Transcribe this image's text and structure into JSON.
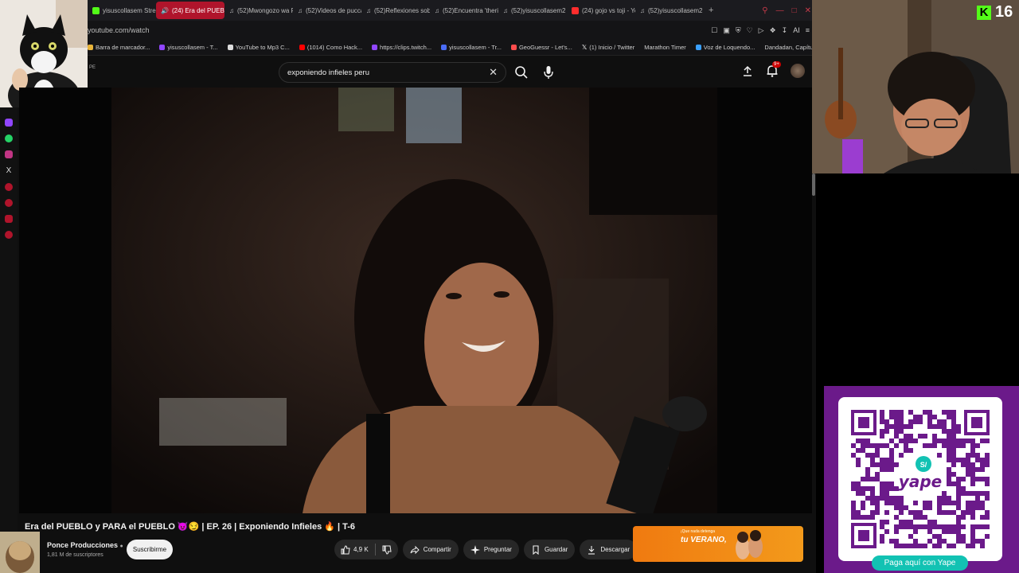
{
  "browser": {
    "tabs": [
      {
        "label": "yisuscollasem Stream",
        "color": "#53fc18"
      },
      {
        "label": "(24) Era del PUEBLO y",
        "color": "#ffffff",
        "active": true
      },
      {
        "label": "(52)Mwongozo wa P",
        "color": "#ffffff"
      },
      {
        "label": "(52)Videos de pucca",
        "color": "#ffffff"
      },
      {
        "label": "(52)Reflexiones sob",
        "color": "#ffffff"
      },
      {
        "label": "(52)Encuentra 'theric",
        "color": "#ffffff"
      },
      {
        "label": "(52)yisuscollasem2",
        "color": "#ffffff"
      },
      {
        "label": "(24) gojo vs toji - Yo",
        "color": "#ff2d2d"
      },
      {
        "label": "(52)yisuscollasem2",
        "color": "#ffffff"
      }
    ],
    "url": "youtube.com/watch",
    "addr_icons_label": "AI",
    "bookmarks": [
      {
        "label": "Barra de marcador...",
        "color": "#e8b43a"
      },
      {
        "label": "yisuscollasem - T...",
        "color": "#9146ff"
      },
      {
        "label": "YouTube to Mp3 C...",
        "color": "#dddddd"
      },
      {
        "label": "(1014) Como Hack...",
        "color": "#ff0000"
      },
      {
        "label": "https://clips.twitch...",
        "color": "#9146ff"
      },
      {
        "label": "yisuscollasem - Tr...",
        "color": "#4a6cf7"
      },
      {
        "label": "GeoGuessr - Let's...",
        "color": "#ff4d4d"
      },
      {
        "label": "(1) Inicio / Twitter",
        "color": "#ffffff"
      },
      {
        "label": "Marathon Timer",
        "color": "#222222"
      },
      {
        "label": "Voz de Loquendo...",
        "color": "#3aa0ff"
      },
      {
        "label": "Dandadan, Capítul...",
        "color": "#222222"
      }
    ]
  },
  "youtube": {
    "country": "PE",
    "search_query": "exponiendo infieles peru",
    "notification_badge": "9+",
    "video_title": "Era del PUEBLO y PARA el PUEBLO 😈😏 | EP. 26 | Exponiendo Infieles 🔥 | T-6",
    "channel_name": "Ponce Producciones",
    "subscribers": "1,81 M de suscriptores",
    "subscribe_label": "Suscribirme",
    "likes": "4,9 K",
    "share_label": "Compartir",
    "ask_label": "Preguntar",
    "save_label": "Guardar",
    "download_label": "Descargar",
    "ad_text": "tu VERANO,",
    "ad_small": "¡Que nada detenga"
  },
  "stream": {
    "kick_viewers": "16",
    "yape_button": "Paga aquí con Yape",
    "yape_logo": "yape",
    "yape_currency": "S/"
  }
}
